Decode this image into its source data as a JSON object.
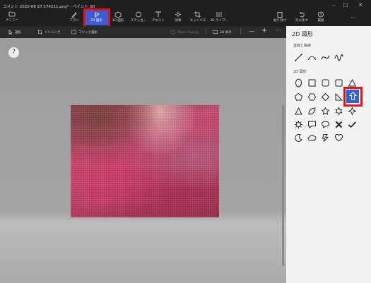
{
  "window": {
    "title": "コメント 2020-08-27 174211.png* - ペイント 3D",
    "controls": [
      "minimize",
      "maximize",
      "close"
    ]
  },
  "ribbon": {
    "menu_label": "メニュー",
    "tools": [
      {
        "label": "ブラシ",
        "icon": "brush-icon"
      },
      {
        "label": "2D 図形",
        "icon": "2d-shapes-icon",
        "active": true
      },
      {
        "label": "3D 図形",
        "icon": "3d-shapes-icon"
      },
      {
        "label": "ステッカー",
        "icon": "sticker-icon"
      },
      {
        "label": "テキスト",
        "icon": "text-icon"
      },
      {
        "label": "効果",
        "icon": "effects-icon"
      },
      {
        "label": "キャンバス",
        "icon": "canvas-icon"
      },
      {
        "label": "3D ライブ...",
        "icon": "3d-library-icon"
      }
    ],
    "right_tools": [
      {
        "label": "貼り付け",
        "icon": "paste-icon"
      },
      {
        "label": "元に戻す",
        "icon": "undo-icon"
      },
      {
        "label": "履歴",
        "icon": "history-icon"
      }
    ]
  },
  "subtoolbar": {
    "select": "選択",
    "crop": "トリミング",
    "magic_select": "マジック選択",
    "mixed_reality": "Mixed Reality",
    "view_3d": "3D 表示",
    "zoom_out": "—",
    "zoom_in": "+",
    "more": "···"
  },
  "canvas": {
    "help": "?",
    "accent_color": "#3c5bd4",
    "highlight_color": "#e3131b"
  },
  "panel": {
    "title": "2D 図形",
    "lines_section": "直線と曲線",
    "shapes_section": "2D 図形"
  }
}
